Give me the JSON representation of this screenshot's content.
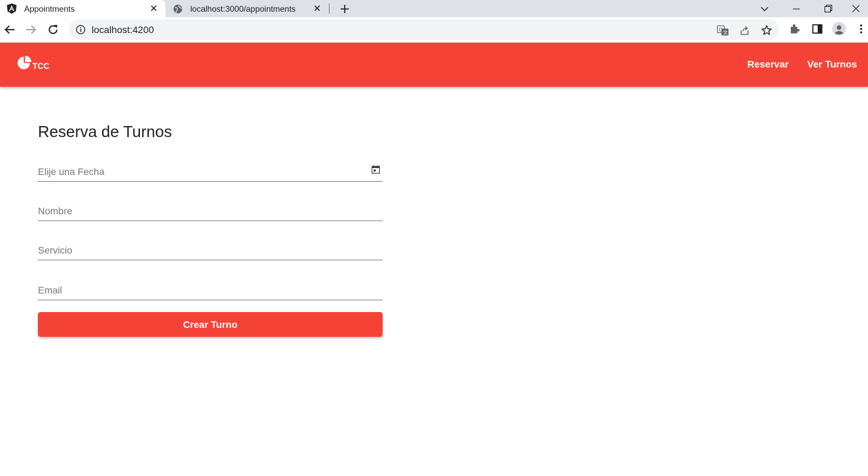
{
  "browser": {
    "tabs": [
      {
        "title": "Appointments",
        "icon": "angular-icon",
        "active": true
      },
      {
        "title": "localhost:3000/appointments",
        "icon": "globe-icon",
        "active": false
      }
    ],
    "url": "localhost:4200"
  },
  "header": {
    "brand": "TCC",
    "nav": [
      {
        "label": "Reservar"
      },
      {
        "label": "Ver Turnos"
      }
    ],
    "color": "#f44336"
  },
  "form": {
    "title": "Reserva de Turnos",
    "fields": [
      {
        "placeholder": "Elije una Fecha",
        "value": "",
        "icon": "calendar-icon"
      },
      {
        "placeholder": "Nombre",
        "value": ""
      },
      {
        "placeholder": "Servicio",
        "value": ""
      },
      {
        "placeholder": "Email",
        "value": ""
      }
    ],
    "submit_label": "Crear Turno"
  }
}
